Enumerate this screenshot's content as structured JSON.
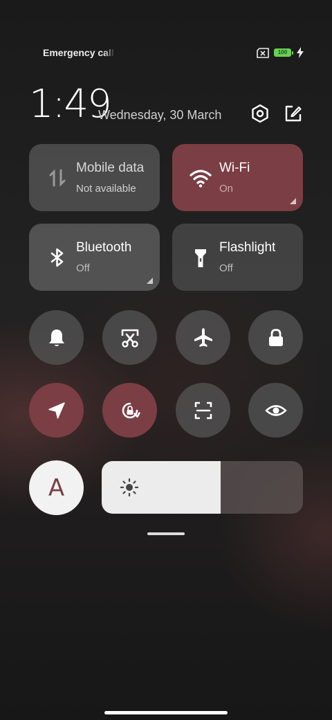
{
  "status": {
    "carrier": "Emergency calls only",
    "battery": "100"
  },
  "header": {
    "time": "1:49",
    "date": "Wednesday, 30 March"
  },
  "tiles": [
    {
      "title": "Mobile data",
      "subtitle": "Not available",
      "icon": "mobile-data-icon",
      "state": "unavailable"
    },
    {
      "title": "Wi-Fi",
      "subtitle": "On",
      "icon": "wifi-icon",
      "state": "on"
    },
    {
      "title": "Bluetooth",
      "subtitle": "Off",
      "icon": "bluetooth-icon",
      "state": "off"
    },
    {
      "title": "Flashlight",
      "subtitle": "Off",
      "icon": "flashlight-icon",
      "state": "off"
    }
  ],
  "toggles": [
    {
      "icon": "bell-icon",
      "active": false
    },
    {
      "icon": "screenshot-icon",
      "active": false
    },
    {
      "icon": "airplane-icon",
      "active": false
    },
    {
      "icon": "lock-icon",
      "active": false
    },
    {
      "icon": "location-icon",
      "active": true
    },
    {
      "icon": "rotation-lock-icon",
      "active": true
    },
    {
      "icon": "scanner-icon",
      "active": false
    },
    {
      "icon": "eye-icon",
      "active": false
    }
  ],
  "auto_brightness_label": "A",
  "brightness": {
    "level": 0.59,
    "icon": "sun-icon"
  },
  "colors": {
    "accent": "#7b3e44",
    "battery": "#6ccf55",
    "tile": "#6e6e6e"
  }
}
